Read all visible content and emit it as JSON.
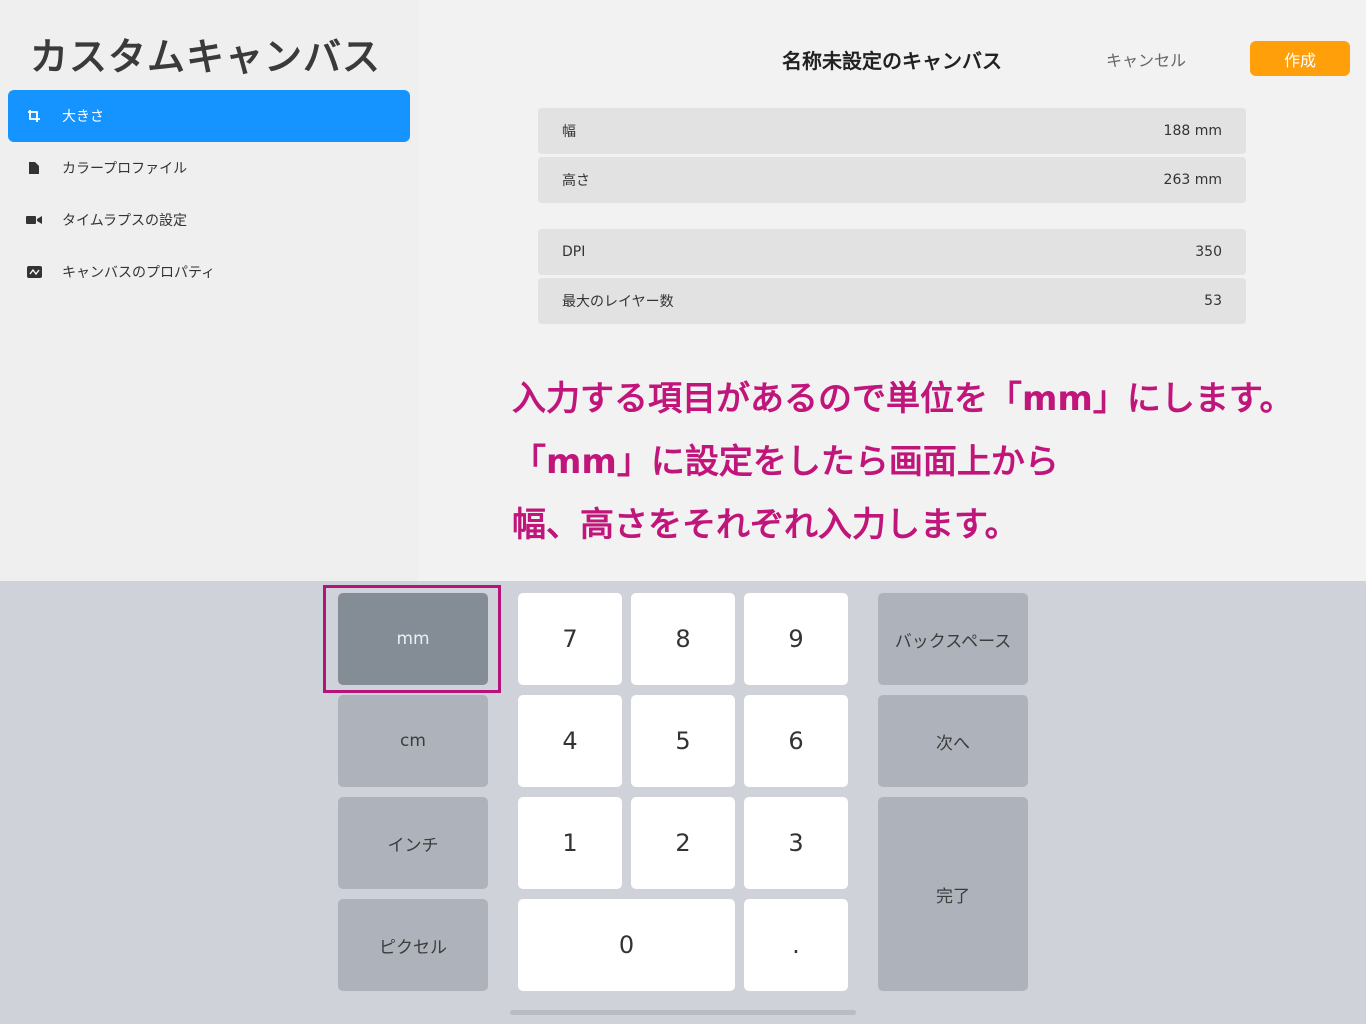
{
  "sidebar": {
    "title": "カスタムキャンバス",
    "items": [
      {
        "label": "大きさ",
        "icon": "crop-icon"
      },
      {
        "label": "カラープロファイル",
        "icon": "color-profile-icon"
      },
      {
        "label": "タイムラプスの設定",
        "icon": "video-camera-icon"
      },
      {
        "label": "キャンバスのプロパティ",
        "icon": "properties-icon"
      }
    ]
  },
  "header": {
    "title": "名称未設定のキャンバス",
    "cancel_label": "キャンセル",
    "create_label": "作成"
  },
  "fields": [
    {
      "label": "幅",
      "value": "188 mm"
    },
    {
      "label": "高さ",
      "value": "263 mm"
    },
    {
      "label": "DPI",
      "value": "350"
    },
    {
      "label": "最大のレイヤー数",
      "value": "53"
    }
  ],
  "annotation": {
    "lines": [
      "入力する項目があるので単位を「mm」にします。",
      "「mm」に設定をしたら画面上から",
      "幅、高さをそれぞれ入力します。"
    ]
  },
  "keypad": {
    "units": [
      "mm",
      "cm",
      "インチ",
      "ピクセル"
    ],
    "selected_unit": "mm",
    "digits": [
      "7",
      "8",
      "9",
      "4",
      "5",
      "6",
      "1",
      "2",
      "3",
      "0",
      "."
    ],
    "backspace_label": "バックスペース",
    "next_label": "次へ",
    "done_label": "完了"
  },
  "colors": {
    "accent": "#1593ff",
    "create_button": "#ff9f0a",
    "annotation": "#c0157a"
  }
}
